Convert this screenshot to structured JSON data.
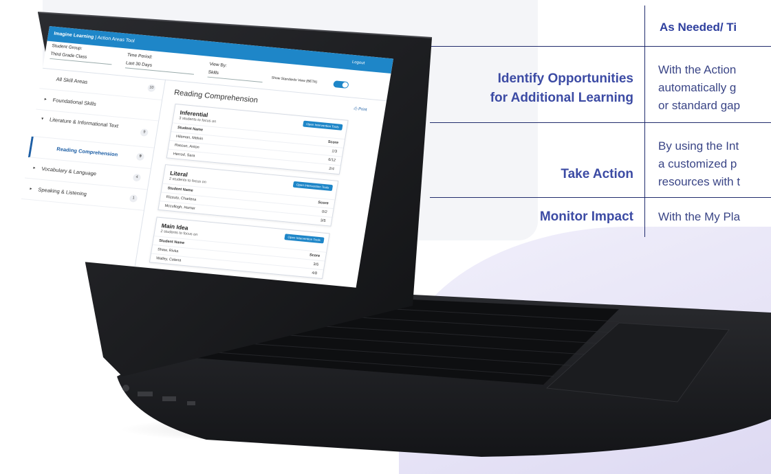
{
  "table": {
    "column_header": "As Needed/ Ti",
    "rows": [
      {
        "label_line1": "Identify Opportunities",
        "label_line2": "for Additional Learning",
        "text_lines": [
          "With the Action",
          "automatically g",
          "or standard gap"
        ]
      },
      {
        "label_line1": "Take Action",
        "label_line2": "",
        "text_lines": [
          "By using the Int",
          "a customized p",
          "resources with t"
        ]
      },
      {
        "label_line1": "Monitor Impact",
        "label_line2": "",
        "text_lines": [
          "With the My Pla"
        ]
      }
    ]
  },
  "app": {
    "brand": "Imagine Learning",
    "title": "| Action Areas Tool",
    "logout_label": "Logout",
    "filters": {
      "student_group_label": "Student Group:",
      "student_group_value": "Third Grade Class",
      "time_period_label": "Time Period:",
      "time_period_value": "Last 30 Days",
      "view_by_label": "View By:",
      "view_by_value": "Skills",
      "standards_toggle_label": "Show Standards View (BETA)"
    },
    "sidebar": [
      {
        "label": "All Skill Areas",
        "count": "10",
        "caret": ""
      },
      {
        "label": "Foundational Skills",
        "count": "",
        "caret": "▸"
      },
      {
        "label": "Literature & Informational Text",
        "count": "9",
        "caret": "▾"
      },
      {
        "label": "Reading Comprehension",
        "count": "9",
        "caret": ""
      },
      {
        "label": "Vocabulary & Language",
        "count": "4",
        "caret": "▸"
      },
      {
        "label": "Speaking & Listening",
        "count": "1",
        "caret": "▸"
      }
    ],
    "main_title": "Reading Comprehension",
    "print_label": "Print",
    "cards": [
      {
        "title": "Inferential",
        "subtitle": "3 students to focus on",
        "button": "Open Intervention Tools",
        "col_name": "Student Name",
        "col_score": "Score",
        "rows": [
          [
            "Hileman, Melvin",
            "1/3"
          ],
          [
            "Rascon, Anton",
            "6/12"
          ],
          [
            "Herrod, Sara",
            "2/4"
          ]
        ]
      },
      {
        "title": "Literal",
        "subtitle": "2 students to focus on",
        "button": "Open Intervention Tools",
        "col_name": "Student Name",
        "col_score": "Score",
        "rows": [
          [
            "Rizzuto, Charlena",
            "0/2"
          ],
          [
            "Mccullogh, Homer",
            "3/5"
          ]
        ]
      },
      {
        "title": "Main Idea",
        "subtitle": "2 students to focus on",
        "button": "Open Intervention Tools",
        "col_name": "Student Name",
        "col_score": "Score",
        "rows": [
          [
            "Shaw, Rivka",
            "3/5"
          ],
          [
            "Walley, Celena",
            "4/8"
          ]
        ]
      }
    ]
  },
  "colors": {
    "accent": "#1e86c8",
    "table_heading": "#3c4ba4",
    "laptop_body": "#1c1d20"
  }
}
